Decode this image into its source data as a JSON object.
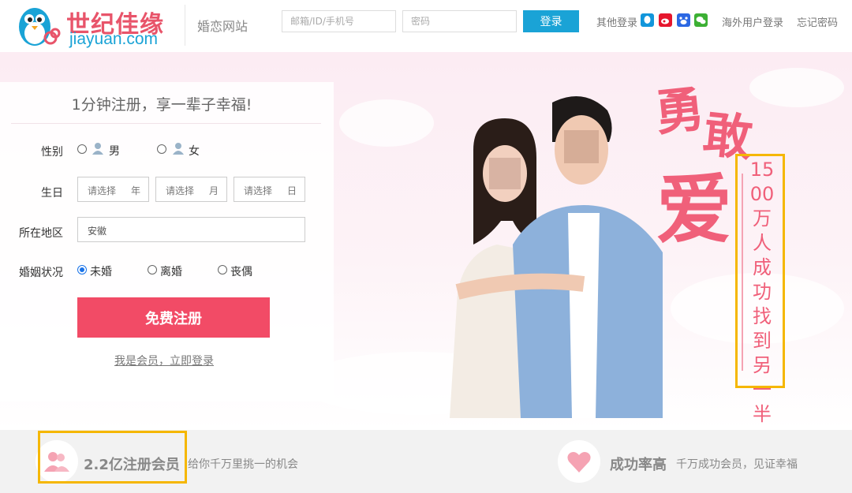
{
  "header": {
    "logo_cn": "世纪佳缘",
    "logo_en": "jiayuan.com",
    "site_label": "婚恋网站",
    "email_placeholder": "邮箱/ID/手机号",
    "password_placeholder": "密码",
    "login_button": "登录",
    "other_login": "其他登录",
    "overseas_login": "海外用户登录",
    "forgot_password": "忘记密码",
    "social_icons": [
      "qq-icon",
      "weibo-icon",
      "baidu-icon",
      "wechat-icon"
    ]
  },
  "form": {
    "title": "1分钟注册，享一辈子幸福!",
    "gender_label": "性别",
    "gender_options": [
      "男",
      "女"
    ],
    "birthday_label": "生日",
    "birthday_placeholder": "请选择",
    "birthday_units": [
      "年",
      "月",
      "日"
    ],
    "region_label": "所在地区",
    "region_value": "安徽",
    "marital_label": "婚姻状况",
    "marital_options": [
      "未婚",
      "离婚",
      "丧偶"
    ],
    "marital_selected": "未婚",
    "register_button": "免费注册",
    "member_login_link": "我是会员，立即登录"
  },
  "hero": {
    "slogan_chars": [
      "勇",
      "敢",
      "爱"
    ],
    "stat_text": "1500万人成功找到另一半"
  },
  "features": [
    {
      "icon": "users-icon",
      "title": "2.2亿注册会员",
      "desc": "给你千万里挑一的机会"
    },
    {
      "icon": "heart-icon",
      "title": "成功率高",
      "desc": "千万成功会员，见证幸福"
    }
  ],
  "colors": {
    "brand_pink": "#f24b66",
    "brand_blue": "#1aa3d6",
    "highlight": "#f5b700"
  }
}
